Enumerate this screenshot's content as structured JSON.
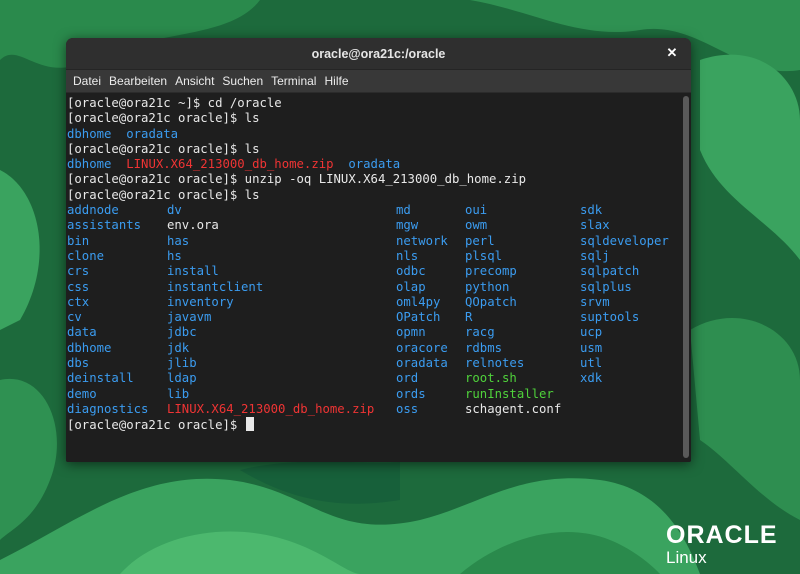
{
  "window": {
    "title": "oracle@ora21c:/oracle",
    "close_symbol": "✕"
  },
  "menu": [
    "Datei",
    "Bearbeiten",
    "Ansicht",
    "Suchen",
    "Terminal",
    "Hilfe"
  ],
  "terminal": {
    "lines": [
      [
        {
          "t": "[oracle@ora21c ~]$ cd /oracle",
          "c": "white"
        }
      ],
      [
        {
          "t": "[oracle@ora21c oracle]$ ls",
          "c": "white"
        }
      ],
      [
        {
          "t": "dbhome",
          "c": "blue"
        },
        {
          "t": "  ",
          "c": "white"
        },
        {
          "t": "oradata",
          "c": "blue"
        }
      ],
      [
        {
          "t": "[oracle@ora21c oracle]$ ls",
          "c": "white"
        }
      ],
      [
        {
          "t": "dbhome",
          "c": "blue"
        },
        {
          "t": "  ",
          "c": "white"
        },
        {
          "t": "LINUX.X64_213000_db_home.zip",
          "c": "red"
        },
        {
          "t": "  ",
          "c": "white"
        },
        {
          "t": "oradata",
          "c": "blue"
        }
      ],
      [
        {
          "t": "[oracle@ora21c oracle]$ unzip -oq LINUX.X64_213000_db_home.zip",
          "c": "white"
        }
      ],
      [
        {
          "t": "[oracle@ora21c oracle]$ ls",
          "c": "white"
        }
      ]
    ],
    "listing_columns": [
      [
        {
          "t": "addnode",
          "c": "blue"
        },
        {
          "t": "assistants",
          "c": "blue"
        },
        {
          "t": "bin",
          "c": "blue"
        },
        {
          "t": "clone",
          "c": "blue"
        },
        {
          "t": "crs",
          "c": "blue"
        },
        {
          "t": "css",
          "c": "blue"
        },
        {
          "t": "ctx",
          "c": "blue"
        },
        {
          "t": "cv",
          "c": "blue"
        },
        {
          "t": "data",
          "c": "blue"
        },
        {
          "t": "dbhome",
          "c": "blue"
        },
        {
          "t": "dbs",
          "c": "blue"
        },
        {
          "t": "deinstall",
          "c": "blue"
        },
        {
          "t": "demo",
          "c": "blue"
        },
        {
          "t": "diagnostics",
          "c": "blue"
        }
      ],
      [
        {
          "t": "dv",
          "c": "blue"
        },
        {
          "t": "env.ora",
          "c": "white"
        },
        {
          "t": "has",
          "c": "blue"
        },
        {
          "t": "hs",
          "c": "blue"
        },
        {
          "t": "install",
          "c": "blue"
        },
        {
          "t": "instantclient",
          "c": "blue"
        },
        {
          "t": "inventory",
          "c": "blue"
        },
        {
          "t": "javavm",
          "c": "blue"
        },
        {
          "t": "jdbc",
          "c": "blue"
        },
        {
          "t": "jdk",
          "c": "blue"
        },
        {
          "t": "jlib",
          "c": "blue"
        },
        {
          "t": "ldap",
          "c": "blue"
        },
        {
          "t": "lib",
          "c": "blue"
        },
        {
          "t": "LINUX.X64_213000_db_home.zip",
          "c": "red"
        }
      ],
      [
        {
          "t": "md",
          "c": "blue"
        },
        {
          "t": "mgw",
          "c": "blue"
        },
        {
          "t": "network",
          "c": "blue"
        },
        {
          "t": "nls",
          "c": "blue"
        },
        {
          "t": "odbc",
          "c": "blue"
        },
        {
          "t": "olap",
          "c": "blue"
        },
        {
          "t": "oml4py",
          "c": "blue"
        },
        {
          "t": "OPatch",
          "c": "blue"
        },
        {
          "t": "opmn",
          "c": "blue"
        },
        {
          "t": "oracore",
          "c": "blue"
        },
        {
          "t": "oradata",
          "c": "blue"
        },
        {
          "t": "ord",
          "c": "blue"
        },
        {
          "t": "ords",
          "c": "blue"
        },
        {
          "t": "oss",
          "c": "blue"
        }
      ],
      [
        {
          "t": "oui",
          "c": "blue"
        },
        {
          "t": "owm",
          "c": "blue"
        },
        {
          "t": "perl",
          "c": "blue"
        },
        {
          "t": "plsql",
          "c": "blue"
        },
        {
          "t": "precomp",
          "c": "blue"
        },
        {
          "t": "python",
          "c": "blue"
        },
        {
          "t": "QOpatch",
          "c": "blue"
        },
        {
          "t": "R",
          "c": "blue"
        },
        {
          "t": "racg",
          "c": "blue"
        },
        {
          "t": "rdbms",
          "c": "blue"
        },
        {
          "t": "relnotes",
          "c": "blue"
        },
        {
          "t": "root.sh",
          "c": "green"
        },
        {
          "t": "runInstaller",
          "c": "green"
        },
        {
          "t": "schagent.conf",
          "c": "white"
        }
      ],
      [
        {
          "t": "sdk",
          "c": "blue"
        },
        {
          "t": "slax",
          "c": "blue"
        },
        {
          "t": "sqldeveloper",
          "c": "blue"
        },
        {
          "t": "sqlj",
          "c": "blue"
        },
        {
          "t": "sqlpatch",
          "c": "blue"
        },
        {
          "t": "sqlplus",
          "c": "blue"
        },
        {
          "t": "srvm",
          "c": "blue"
        },
        {
          "t": "suptools",
          "c": "blue"
        },
        {
          "t": "ucp",
          "c": "blue"
        },
        {
          "t": "usm",
          "c": "blue"
        },
        {
          "t": "utl",
          "c": "blue"
        },
        {
          "t": "xdk",
          "c": "blue"
        },
        {
          "t": "",
          "c": "blue"
        },
        {
          "t": "",
          "c": "blue"
        }
      ]
    ],
    "prompt": "[oracle@ora21c oracle]$ "
  },
  "logo": {
    "brand": "ORACLE",
    "sub": "Linux"
  },
  "colors": {
    "dir_blue": "#3b9cf0",
    "archive_red": "#ef3434",
    "exec_green": "#4fd23b",
    "wallpaper_green": "#1f6b3f"
  }
}
